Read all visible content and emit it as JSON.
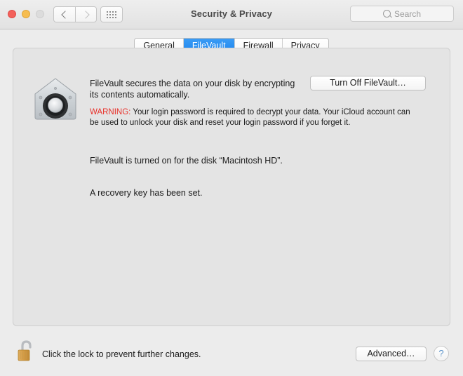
{
  "window": {
    "title": "Security & Privacy",
    "traffic_lights": [
      "close",
      "minimize",
      "zoom"
    ],
    "nav": {
      "back_icon": "chevron-left-icon",
      "forward_icon": "chevron-right-icon",
      "show_all_icon": "grid-icon"
    },
    "search": {
      "placeholder": "Search",
      "value": "",
      "icon": "search-icon"
    }
  },
  "tabs": [
    {
      "label": "General",
      "active": false
    },
    {
      "label": "FileVault",
      "active": true
    },
    {
      "label": "Firewall",
      "active": false
    },
    {
      "label": "Privacy",
      "active": false
    }
  ],
  "filevault": {
    "icon_name": "filevault-vault-icon",
    "description": "FileVault secures the data on your disk by encrypting its contents automatically.",
    "turn_off_button": "Turn Off FileVault…",
    "warning_label": "WARNING:",
    "warning_text": " Your login password is required to decrypt your data. Your iCloud account can be used to unlock your disk and reset your login password if you forget it.",
    "status_disk": "FileVault is turned on for the disk “Macintosh HD”.",
    "status_recovery": "A recovery key has been set."
  },
  "footer": {
    "lock_icon": "unlocked-padlock-icon",
    "lock_text": "Click the lock to prevent further changes.",
    "advanced_button": "Advanced…",
    "help_button": "?"
  },
  "colors": {
    "accent_blue": "#1c84ef",
    "warning_red": "#e8312a",
    "panel_bg": "#e4e4e4",
    "window_bg": "#ececec",
    "help_blue": "#5b93c9",
    "lock_gold": "#d9a04a"
  }
}
